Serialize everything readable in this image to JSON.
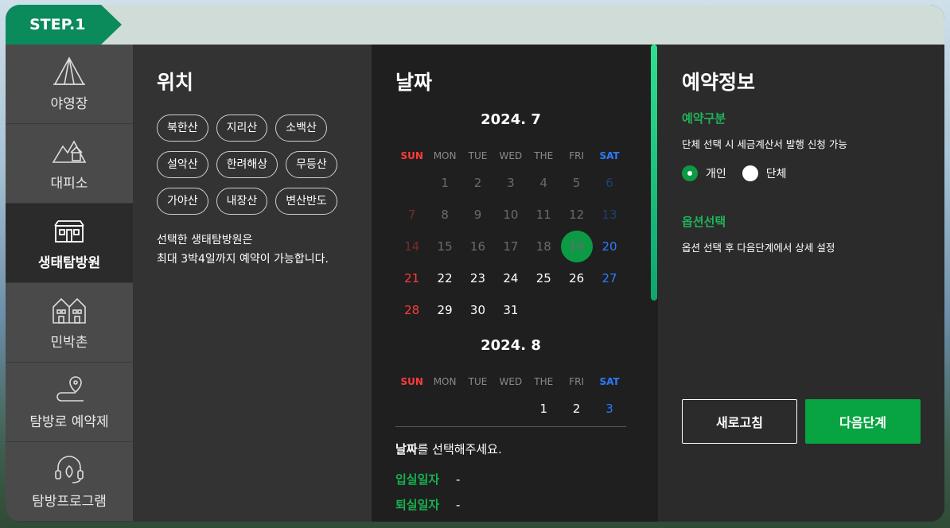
{
  "step_label": "STEP.1",
  "nav": [
    {
      "label": "야영장",
      "icon": "tent-icon",
      "active": false
    },
    {
      "label": "대피소",
      "icon": "mountain-hut-icon",
      "active": false
    },
    {
      "label": "생태탐방원",
      "icon": "eco-center-building-icon",
      "active": true
    },
    {
      "label": "민박촌",
      "icon": "houses-icon",
      "active": false
    },
    {
      "label": "탐방로 예약제",
      "icon": "trail-route-icon",
      "active": false
    },
    {
      "label": "탐방프로그램",
      "icon": "program-headset-icon",
      "active": false
    }
  ],
  "location": {
    "title": "위치",
    "chips": [
      "북한산",
      "지리산",
      "소백산",
      "설악산",
      "한려해상",
      "무등산",
      "가야산",
      "내장산",
      "변산반도"
    ],
    "note_line1": "선택한 생태탐방원은",
    "note_line2": "최대 3박4일까지 예약이 가능합니다."
  },
  "date": {
    "title": "날짜",
    "weekdays": [
      "SUN",
      "MON",
      "TUE",
      "WED",
      "THE",
      "FRI",
      "SAT"
    ],
    "months": [
      {
        "title": "2024. 7",
        "days": [
          "",
          "1",
          "2",
          "3",
          "4",
          "5",
          "6",
          "7",
          "8",
          "9",
          "10",
          "11",
          "12",
          "13",
          "14",
          "15",
          "16",
          "17",
          "18",
          "19",
          "20",
          "21",
          "22",
          "23",
          "24",
          "25",
          "26",
          "27",
          "28",
          "29",
          "30",
          "31"
        ],
        "past_until": 19,
        "today": "19"
      },
      {
        "title": "2024. 8",
        "days": [
          "",
          "",
          "",
          "",
          "1",
          "2",
          "3"
        ],
        "past_until": 0,
        "today": ""
      }
    ],
    "select_prompt_bold": "날짜",
    "select_prompt_rest": "를 선택해주세요.",
    "checkin_label": "입실일자",
    "checkin_value": "-",
    "checkout_label": "퇴실일자",
    "checkout_value": "-"
  },
  "info": {
    "title": "예약정보",
    "type_label": "예약구분",
    "type_desc": "단체 선택 시 세금계산서 발행 신청 가능",
    "radio_individual": "개인",
    "radio_group": "단체",
    "option_label": "옵션선택",
    "option_desc": "옵션 선택 후 다음단계에서 상세 설정",
    "refresh_label": "새로고침",
    "next_label": "다음단계"
  },
  "colors": {
    "accent": "#0c9a44",
    "step_tab": "#0b8a5b",
    "sunday": "#ff3b3b",
    "saturday": "#2f7bff"
  }
}
